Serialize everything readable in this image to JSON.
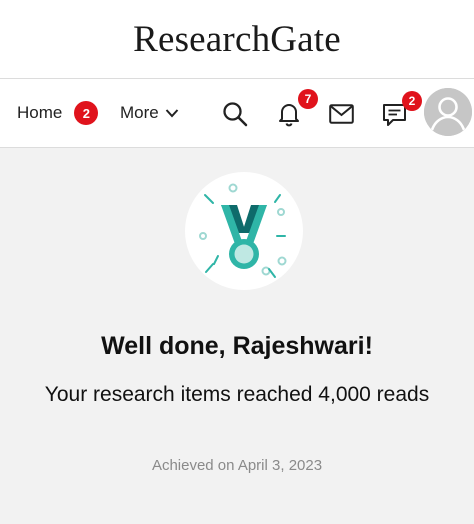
{
  "brand": {
    "name": "ResearchGate"
  },
  "nav": {
    "home_label": "Home",
    "home_badge": "2",
    "more_label": "More",
    "notifications_badge": "7",
    "messages_badge": "2"
  },
  "icons": [
    "search-icon",
    "bell-icon",
    "mail-icon",
    "chat-icon",
    "avatar-icon",
    "medal-icon",
    "chevron-down-icon"
  ],
  "colors": {
    "badge": "#e0131c",
    "medal_teal": "#2fb5a7",
    "medal_dark": "#0e6b6b",
    "background": "#f2f2f2"
  },
  "achievement": {
    "title": "Well done, Rajeshwari!",
    "message": "Your research items reached 4,000 reads",
    "date": "Achieved on April 3, 2023"
  }
}
